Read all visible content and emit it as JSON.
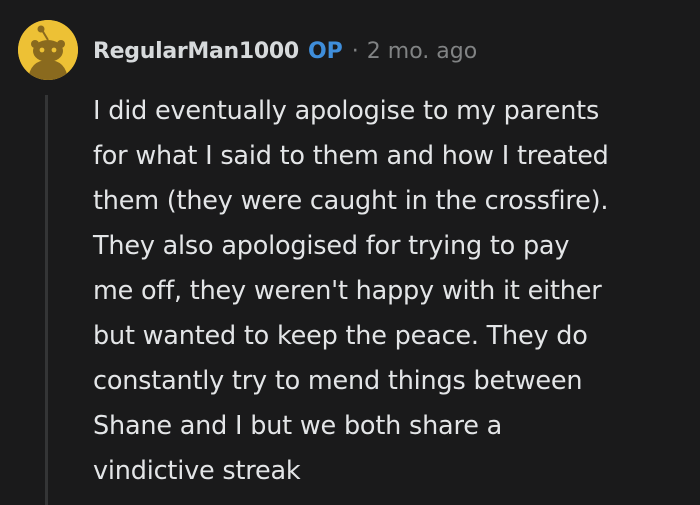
{
  "comment": {
    "avatar_icon": "snoo-avatar-icon",
    "username": "RegularMan1000",
    "op_badge": "OP",
    "separator": "·",
    "timestamp": "2 mo. ago",
    "body_lines": [
      "I did eventually apologise to my parents",
      "for what I said to them and how I treated",
      "them (they were caught in the crossfire).",
      "They also apologised for trying to pay",
      "me off, they weren't happy with it either",
      "but wanted to keep the peace. They do",
      "constantly try to mend things between",
      "Shane and I but we both share a",
      "vindictive streak"
    ]
  },
  "colors": {
    "background": "#1a1a1b",
    "avatar_bg": "#edc135",
    "op_badge": "#3f8edb",
    "meta_text": "#818384",
    "body_text": "#e3e5e7",
    "thread_line": "#343536"
  }
}
